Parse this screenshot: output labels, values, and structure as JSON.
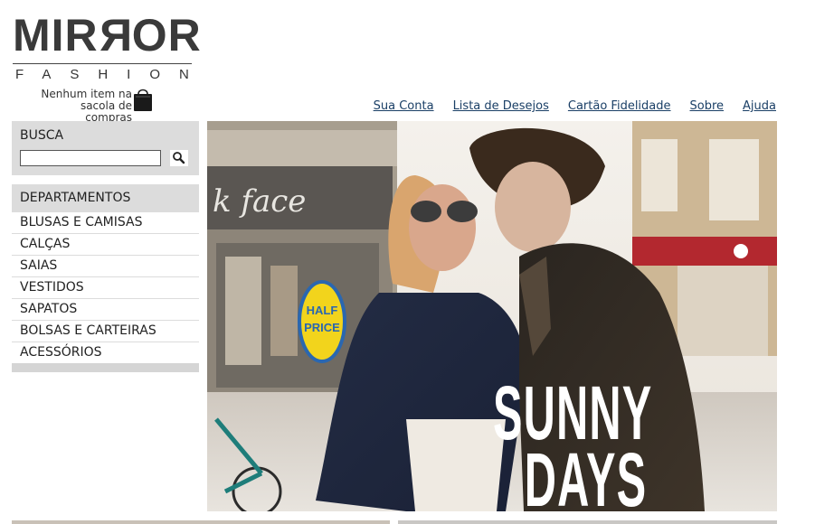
{
  "brand": {
    "logo_text": "MIRROR",
    "logo_sub": "FASHION"
  },
  "cart": {
    "status": "Nenhum item na sacola de compras",
    "icon": "shopping-bag-icon"
  },
  "top_nav": [
    "Sua Conta",
    "Lista de Desejos",
    "Cartão Fidelidade",
    "Sobre",
    "Ajuda"
  ],
  "search": {
    "title": "BUSCA",
    "value": "",
    "placeholder": "",
    "icon": "search-icon"
  },
  "departments": {
    "title": "DEPARTAMENTOS",
    "items": [
      "BLUSAS E CAMISAS",
      "CALÇAS",
      "SAIAS",
      "VESTIDOS",
      "SAPATOS",
      "BOLSAS E CARTEIRAS",
      "ACESSÓRIOS"
    ]
  },
  "banner": {
    "headline_1": "SUNNY",
    "headline_2": "DAYS",
    "store_sign_1": "k face",
    "store_sign_2": "HALF PRICE"
  },
  "colors": {
    "link": "#1a3f66",
    "panel": "#dcdcdc",
    "logo": "#3a3a3a"
  }
}
